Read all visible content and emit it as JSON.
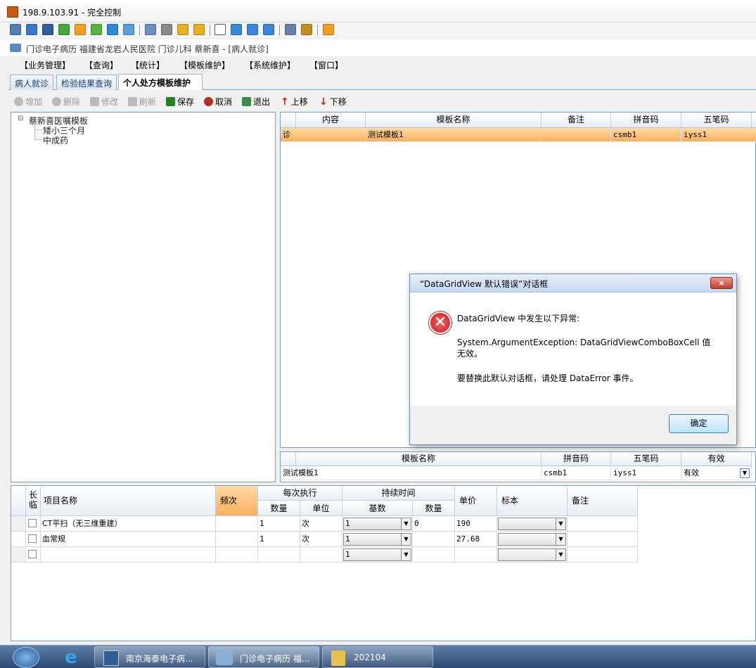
{
  "window": {
    "title": "198.9.103.91 - 完全控制"
  },
  "app_header": {
    "text": "门诊电子病历  福建省龙岩人民医院  门诊儿科  蔡新喜 - [病人就诊]"
  },
  "menu": [
    "【业务管理】",
    "【查询】",
    "【统计】",
    "【模板维护】",
    "【系统维护】",
    "【窗口】"
  ],
  "tabs": [
    "病人就诊",
    "检验结果查询",
    "个人处方模板维护"
  ],
  "toolbar": {
    "add": "增加",
    "delete": "删除",
    "edit": "修改",
    "refresh": "刷新",
    "save": "保存",
    "cancel": "取消",
    "exit": "退出",
    "move_up": "上移",
    "move_down": "下移"
  },
  "tree": {
    "root": "蔡新喜医嘱模板",
    "children": [
      "矮小三个月",
      "中成药"
    ]
  },
  "template_grid": {
    "headers": [
      "内容",
      "模板名称",
      "备注",
      "拼音码",
      "五笔码"
    ],
    "row": {
      "content": "诊",
      "name": "测试模板1",
      "note": "",
      "pinyin": "csmb1",
      "wubi": "iyss1"
    }
  },
  "detail_grid": {
    "headers": [
      "模板名称",
      "拼音码",
      "五笔码",
      "有效"
    ],
    "row": {
      "name": "测试模板1",
      "pinyin": "csmb1",
      "wubi": "iyss1",
      "valid": "有效"
    }
  },
  "dialog": {
    "title": "“DataGridView 默认错误”对话框",
    "close": "×",
    "line1": "DataGridView 中发生以下异常:",
    "line2": "System.ArgumentException: DataGridViewComboBoxCell 值无效。",
    "line3": "要替换此默认对话框，请处理 DataError 事件。",
    "ok": "确定"
  },
  "items_grid": {
    "h_long": "长临",
    "h_name": "项目名称",
    "h_freq": "频次",
    "h_each": "每次执行",
    "h_qty": "数量",
    "h_unit": "单位",
    "h_dur": "持续时间",
    "h_base": "基数",
    "h_qty2": "数量",
    "h_price": "单价",
    "h_spec": "标本",
    "h_note": "备注",
    "rows": [
      {
        "name": "CT平扫（无三维重建）",
        "qty": "1",
        "unit": "次",
        "base": "1",
        "qty2": "0",
        "price": "190"
      },
      {
        "name": "血常规",
        "qty": "1",
        "unit": "次",
        "base": "1",
        "qty2": "",
        "price": "27.68"
      },
      {
        "name": "",
        "qty": "",
        "unit": "",
        "base": "1",
        "qty2": "",
        "price": ""
      }
    ]
  },
  "taskbar": {
    "items": [
      "南京海泰电子病...",
      "门诊电子病历  福...",
      "202104"
    ]
  }
}
